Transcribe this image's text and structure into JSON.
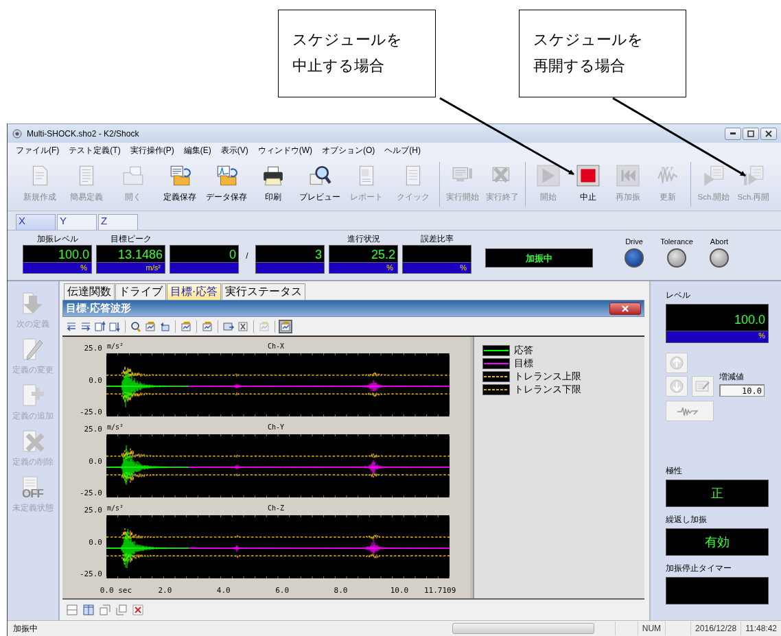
{
  "callouts": [
    {
      "lines": [
        "スケジュールを",
        "中止する場合"
      ]
    },
    {
      "lines": [
        "スケジュールを",
        "再開する場合"
      ]
    }
  ],
  "window": {
    "title": "Multi-SHOCK.sho2 - K2/Shock"
  },
  "menu": [
    "ファイル(F)",
    "テスト定義(T)",
    "実行操作(P)",
    "編集(E)",
    "表示(V)",
    "ウィンドウ(W)",
    "オプション(O)",
    "ヘルプ(H)"
  ],
  "toolbar_groups": [
    [
      {
        "label": "新規作成",
        "disabled": true
      },
      {
        "label": "簡易定義",
        "disabled": true
      },
      {
        "label": "開く",
        "disabled": true
      },
      {
        "label": "定義保存",
        "disabled": false
      },
      {
        "label": "データ保存",
        "disabled": false
      },
      {
        "label": "印刷",
        "disabled": false
      },
      {
        "label": "プレビュー",
        "disabled": false
      },
      {
        "label": "レポート",
        "disabled": true
      },
      {
        "label": "クイック",
        "disabled": true
      }
    ],
    [
      {
        "label": "実行開始",
        "disabled": true
      },
      {
        "label": "実行終了",
        "disabled": true
      }
    ],
    [
      {
        "label": "開始",
        "disabled": true
      },
      {
        "label": "中止",
        "disabled": false
      },
      {
        "label": "再加振",
        "disabled": true
      },
      {
        "label": "更新",
        "disabled": true
      }
    ],
    [
      {
        "label": "Sch.開始",
        "disabled": true
      },
      {
        "label": "Sch.再開",
        "disabled": true
      }
    ]
  ],
  "channel_tabs": [
    {
      "label": "X",
      "selected": true
    },
    {
      "label": "Y",
      "selected": false
    },
    {
      "label": "Z",
      "selected": false
    }
  ],
  "meters": [
    {
      "kind": "meter",
      "label": "加振レベル",
      "value": "100.0",
      "unit": "%"
    },
    {
      "kind": "meter",
      "label": "目標ピーク",
      "value": "13.1486",
      "unit": "m/s²"
    },
    {
      "kind": "meter",
      "value": "0"
    },
    {
      "kind": "slash",
      "text": "/"
    },
    {
      "kind": "meter",
      "value": "3"
    },
    {
      "kind": "meter",
      "label": "進行状況",
      "value": "25.2",
      "unit": "%"
    },
    {
      "kind": "meter",
      "label": "誤差比率",
      "unit": "%"
    }
  ],
  "run_status": "加振中",
  "lamps": [
    {
      "label": "Drive",
      "on": true
    },
    {
      "label": "Tolerance",
      "on": false
    },
    {
      "label": "Abort",
      "on": false
    }
  ],
  "sidebar": [
    {
      "label": "次の定義",
      "disabled": true
    },
    {
      "label": "定義の変更",
      "disabled": true
    },
    {
      "label": "定義の追加",
      "disabled": true
    },
    {
      "label": "定義の削除",
      "disabled": true
    },
    {
      "label": "未定義状態",
      "disabled": true,
      "badge": "OFF"
    }
  ],
  "view_tabs": [
    {
      "label": "伝達関数",
      "selected": false
    },
    {
      "label": "ドライブ",
      "selected": false
    },
    {
      "label": "目標·応答",
      "selected": true
    },
    {
      "label": "実行ステータス",
      "selected": false
    }
  ],
  "panel": {
    "title": "目標·応答波形",
    "toolbar_groups": [
      [
        {
          "disabled": false,
          "pressed": false
        },
        {
          "disabled": false,
          "pressed": false
        },
        {
          "disabled": false,
          "pressed": false
        },
        {
          "disabled": false,
          "pressed": false
        }
      ],
      [
        {
          "disabled": false,
          "pressed": false
        },
        {
          "disabled": false,
          "pressed": false
        },
        {
          "disabled": false,
          "pressed": false
        }
      ],
      [
        {
          "disabled": false,
          "pressed": false
        }
      ],
      [
        {
          "disabled": false,
          "pressed": false
        }
      ],
      [
        {
          "disabled": false,
          "pressed": false
        },
        {
          "disabled": false,
          "pressed": false
        }
      ],
      [
        {
          "disabled": true,
          "pressed": false
        }
      ],
      [
        {
          "disabled": false,
          "pressed": true
        }
      ]
    ]
  },
  "plots": [
    {
      "title": "Ch-X",
      "unit": "m/s²",
      "yticks": [
        "25.0",
        "0.0",
        "-25.0"
      ]
    },
    {
      "title": "Ch-Y",
      "unit": "m/s²",
      "yticks": [
        "25.0",
        "0.0",
        "-25.0"
      ]
    },
    {
      "title": "Ch-Z",
      "unit": "m/s²",
      "yticks": [
        "25.0",
        "0.0",
        "-25.0"
      ]
    }
  ],
  "xticks": [
    "0.0 sec",
    "2.0",
    "4.0",
    "6.0",
    "8.0",
    "10.0",
    "11.7109"
  ],
  "legend": [
    {
      "label": "応答",
      "color": "#00ff00",
      "dashed": false
    },
    {
      "label": "目標",
      "color": "#ff00ff",
      "dashed": false
    },
    {
      "label": "トレランス上限",
      "color": "#e6b400",
      "dashed": true
    },
    {
      "label": "トレランス下限",
      "color": "#e6b400",
      "dashed": true
    }
  ],
  "right_panel": {
    "level": {
      "label": "レベル",
      "value": "100.0",
      "unit": "%"
    },
    "step": {
      "label": "増減値",
      "value": "10.0"
    },
    "displays": [
      {
        "label": "極性",
        "value": "正"
      },
      {
        "label": "繰返し加振",
        "value": "有効"
      },
      {
        "label": "加振停止タイマー"
      }
    ]
  },
  "status_bar": {
    "message": "加振中",
    "progress": {
      "level": 0
    },
    "indicator": "NUM",
    "date": "2016/12/28",
    "time": "11:48:42"
  }
}
